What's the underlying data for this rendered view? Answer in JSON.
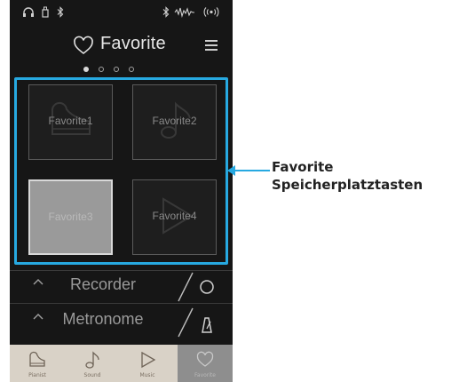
{
  "header": {
    "title": "Favorite",
    "page_count": 4,
    "active_page": 1
  },
  "status_icons": [
    "headphones-icon",
    "usb-icon",
    "bluetooth-icon",
    "bluetooth-audio-icon",
    "sound-wave-icon",
    "wireless-icon"
  ],
  "favorites": [
    {
      "label": "Favorite1",
      "icon": "piano-icon",
      "selected": false
    },
    {
      "label": "Favorite2",
      "icon": "note-icon",
      "selected": false
    },
    {
      "label": "Favorite3",
      "icon": "",
      "selected": true
    },
    {
      "label": "Favorite4",
      "icon": "play-icon",
      "selected": false
    }
  ],
  "panels": {
    "recorder": {
      "label": "Recorder",
      "icon": "record-icon"
    },
    "metronome": {
      "label": "Metronome",
      "icon": "metronome-icon"
    }
  },
  "bottom_nav": [
    {
      "label": "Pianist",
      "icon": "piano-icon",
      "active": false
    },
    {
      "label": "Sound",
      "icon": "note-icon",
      "active": false
    },
    {
      "label": "Music",
      "icon": "play-icon",
      "active": false
    },
    {
      "label": "Favorite",
      "icon": "heart-icon",
      "active": true
    }
  ],
  "callout": {
    "line1": "Favorite",
    "line2": "Speicherplatztasten",
    "color": "#27a9e1"
  }
}
